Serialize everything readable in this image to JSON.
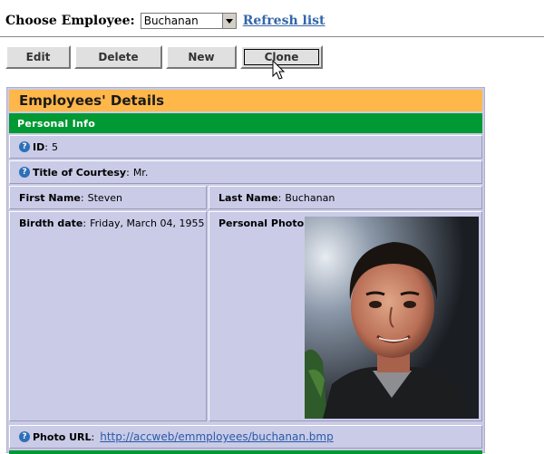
{
  "header": {
    "choose_label": "Choose Employee:",
    "selected_employee": "Buchanan",
    "refresh_link": "Refresh list"
  },
  "toolbar": {
    "edit_label": "Edit",
    "delete_label": "Delete",
    "new_label": "New",
    "clone_label": "Clone"
  },
  "details": {
    "title": "Employees' Details",
    "section": "Personal Info",
    "id_label": "ID",
    "id_value": "5",
    "courtesy_label": "Title of Courtesy",
    "courtesy_value": "Mr.",
    "first_name_label": "First Name",
    "first_name_value": "Steven",
    "last_name_label": "Last Name",
    "last_name_value": "Buchanan",
    "birth_label": "Birdth date",
    "birth_value": "Friday, March 04, 1955",
    "photo_label": "Personal Photo",
    "photo_url_label": "Photo URL",
    "photo_url_value": "http://accweb/emmployees/buchanan.bmp"
  },
  "icons": {
    "help": "help-circle-icon",
    "dropdown": "dropdown-arrow-icon",
    "cursor": "mouse-pointer-icon"
  },
  "colors": {
    "title_bar": "#ffb74a",
    "section_bar": "#009933",
    "panel_bg": "#c9cbe7",
    "link": "#3366aa"
  }
}
